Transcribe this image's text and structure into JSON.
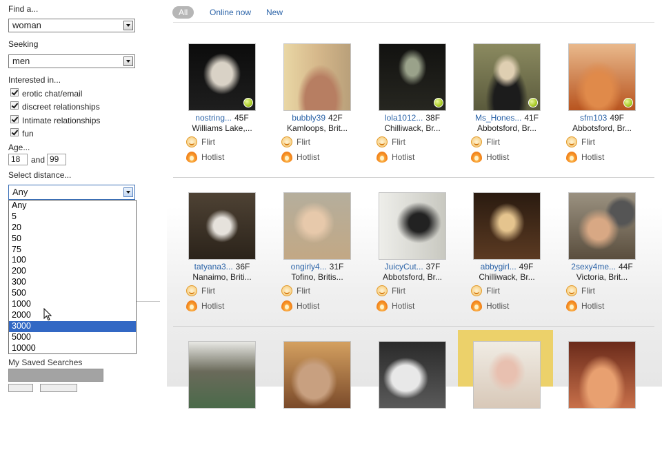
{
  "sidebar": {
    "find_label": "Find a...",
    "find_value": "woman",
    "seeking_label": "Seeking",
    "seeking_value": "men",
    "interested_label": "Interested in...",
    "interests": [
      {
        "label": "erotic chat/email",
        "checked": true
      },
      {
        "label": "discreet relationships",
        "checked": true
      },
      {
        "label": "Intimate relationships",
        "checked": true
      },
      {
        "label": "fun",
        "checked": true
      }
    ],
    "age_label": "Age...",
    "age_min": "18",
    "age_and": "and",
    "age_max": "99",
    "distance_label": "Select distance...",
    "distance_value": "Any",
    "distance_options": [
      "Any",
      "5",
      "20",
      "50",
      "75",
      "100",
      "200",
      "300",
      "500",
      "1000",
      "2000",
      "3000",
      "5000",
      "10000"
    ],
    "distance_highlighted": "3000",
    "saved_searches_label": "My Saved Searches"
  },
  "tabs": [
    {
      "label": "All",
      "active": true
    },
    {
      "label": "Online now",
      "active": false
    },
    {
      "label": "New",
      "active": false
    }
  ],
  "actions": {
    "flirt": "Flirt",
    "hotlist": "Hotlist"
  },
  "profiles": [
    {
      "name": "nostring...",
      "age": "45F",
      "location": "Williams Lake,...",
      "online": true,
      "photo": "#1c1c1c"
    },
    {
      "name": "bubbly39",
      "age": "42F",
      "location": "Kamloops, Brit...",
      "online": false,
      "photo": "#c9a27a"
    },
    {
      "name": "lola1012...",
      "age": "38F",
      "location": "Chilliwack, Br...",
      "online": true,
      "photo": "#1b1b18"
    },
    {
      "name": "Ms_Hones...",
      "age": "41F",
      "location": "Abbotsford, Br...",
      "online": true,
      "photo": "#6d6b4a"
    },
    {
      "name": "sfm103",
      "age": "49F",
      "location": "Abbotsford, Br...",
      "online": true,
      "photo": "#c9733a"
    },
    {
      "name": "tatyana3...",
      "age": "36F",
      "location": "Nanaimo, Briti...",
      "online": false,
      "photo": "#6b5d4c"
    },
    {
      "name": "ongirly4...",
      "age": "31F",
      "location": "Tofino, Britis...",
      "online": false,
      "photo": "#b8a184"
    },
    {
      "name": "JuicyCut...",
      "age": "37F",
      "location": "Abbotsford, Br...",
      "online": false,
      "photo": "#d4d4cf"
    },
    {
      "name": "abbygirl...",
      "age": "49F",
      "location": "Chilliwack, Br...",
      "online": false,
      "photo": "#4a3120"
    },
    {
      "name": "2sexy4me...",
      "age": "44F",
      "location": "Victoria, Brit...",
      "online": false,
      "photo": "#7a6a54"
    },
    {
      "name": "",
      "age": "",
      "location": "",
      "online": false,
      "photo": "#5e6a5a"
    },
    {
      "name": "",
      "age": "",
      "location": "",
      "online": false,
      "photo": "#8a6a4a"
    },
    {
      "name": "",
      "age": "",
      "location": "",
      "online": false,
      "photo": "#3e3e3e"
    },
    {
      "name": "",
      "age": "",
      "location": "",
      "online": false,
      "photo": "#e2d4c4"
    },
    {
      "name": "",
      "age": "",
      "location": "",
      "online": false,
      "photo": "#a8624a"
    }
  ],
  "colors": {
    "link": "#2c64a8",
    "selected_option": "#3268c4",
    "tab_active": "#b6b6b6",
    "highlight_frame": "#ecd16a"
  }
}
